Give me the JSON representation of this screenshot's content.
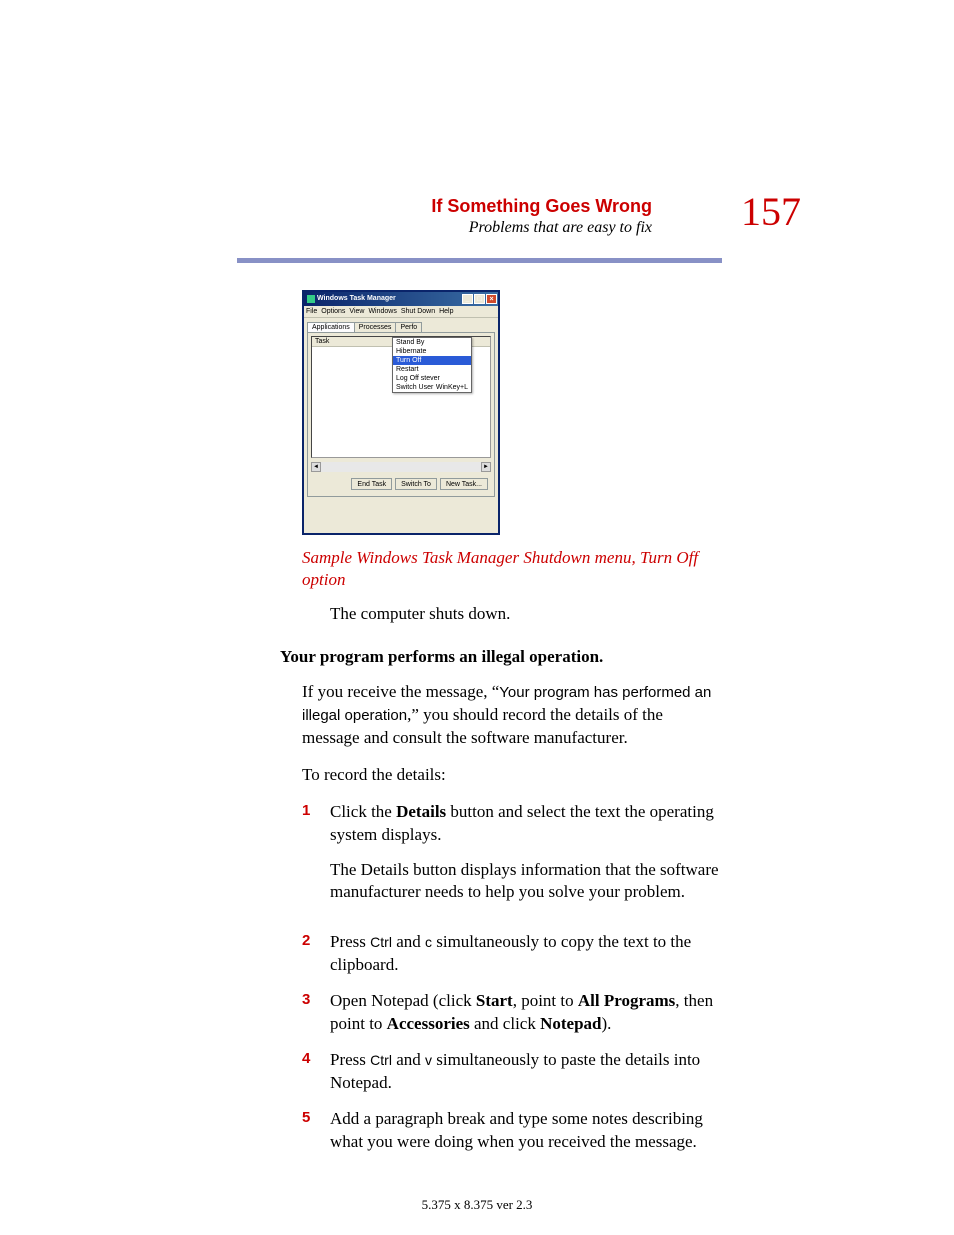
{
  "header": {
    "title": "If Something Goes Wrong",
    "subtitle": "Problems that are easy to fix",
    "page_number": "157"
  },
  "task_manager": {
    "window_title": "Windows Task Manager",
    "menubar": [
      "File",
      "Options",
      "View",
      "Windows",
      "Shut Down",
      "Help"
    ],
    "tabs": [
      "Applications",
      "Processes",
      "Perfo"
    ],
    "list_header": "Task",
    "dropdown": {
      "items": [
        {
          "label": "Stand By",
          "shortcut": ""
        },
        {
          "label": "Hibernate",
          "shortcut": ""
        },
        {
          "label": "Turn Off",
          "shortcut": "",
          "highlighted": true
        },
        {
          "label": "Restart",
          "shortcut": ""
        },
        {
          "label": "Log Off stever",
          "shortcut": ""
        },
        {
          "label": "Switch User",
          "shortcut": "WinKey+L"
        }
      ]
    },
    "buttons": {
      "end_task": "End Task",
      "switch_to": "Switch To",
      "new_task": "New Task..."
    }
  },
  "caption": "Sample Windows Task Manager Shutdown menu, Turn Off option",
  "body": {
    "shuts_down": "The computer shuts down.",
    "heading": "Your program performs an illegal operation.",
    "intro_1": "If you receive the message, “",
    "intro_msg": "Your program has performed an illegal operation",
    "intro_2": ",” you should record the details of the message and consult the software manufacturer.",
    "record": "To record the details:"
  },
  "steps": [
    {
      "num": "1",
      "text_parts": [
        "Click the ",
        "Details",
        " button and select the text the operating system displays."
      ],
      "note": "The Details button displays information that the software manufacturer needs to help you solve your problem."
    },
    {
      "num": "2",
      "text_parts": [
        "Press ",
        "Ctrl",
        " and ",
        "c",
        " simultaneously to copy the text to the clipboard."
      ]
    },
    {
      "num": "3",
      "text_parts": [
        "Open Notepad (click ",
        "Start",
        ", point to ",
        "All Programs",
        ", then point to ",
        "Accessories",
        " and click ",
        "Notepad",
        ")."
      ]
    },
    {
      "num": "4",
      "text_parts": [
        "Press ",
        "Ctrl",
        " and ",
        "v",
        " simultaneously to paste the details into Notepad."
      ]
    },
    {
      "num": "5",
      "text_parts": [
        "Add a paragraph break and type some notes describing what you were doing when you received the message."
      ]
    }
  ],
  "footer": "5.375 x 8.375 ver 2.3"
}
